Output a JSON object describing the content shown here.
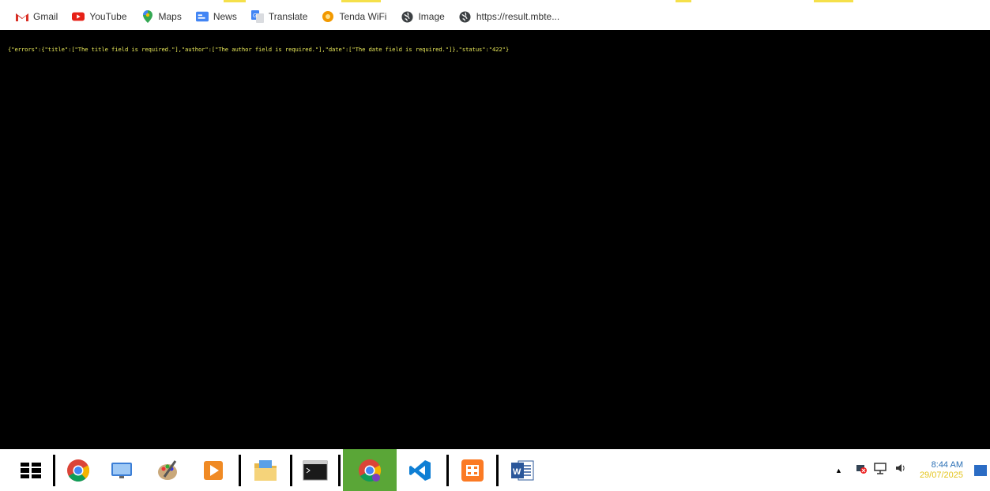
{
  "bookmarks": [
    {
      "label": "Gmail",
      "icon": "gmail-icon"
    },
    {
      "label": "YouTube",
      "icon": "youtube-icon"
    },
    {
      "label": "Maps",
      "icon": "maps-icon"
    },
    {
      "label": "News",
      "icon": "news-icon"
    },
    {
      "label": "Translate",
      "icon": "translate-icon"
    },
    {
      "label": "Tenda WiFi",
      "icon": "tenda-wifi-icon"
    },
    {
      "label": "Image",
      "icon": "globe-icon"
    },
    {
      "label": "https://result.mbte...",
      "icon": "globe-icon"
    }
  ],
  "response": {
    "text": "{\"errors\":{\"title\":[\"The title field is required.\"],\"author\":[\"The author field is required.\"],\"date\":[\"The date field is required.\"]},\"status\":\"422\"}"
  },
  "taskbar": {
    "apps": [
      "windows-start-icon",
      "chrome-icon",
      "remote-desktop-icon",
      "paint-icon",
      "media-player-icon",
      "file-explorer-icon",
      "terminal-icon",
      "chrome-profile-icon",
      "vscode-icon",
      "xampp-icon",
      "word-icon"
    ],
    "clock": {
      "time": "8:44 AM",
      "date": "29/07/2025"
    }
  },
  "colors": {
    "accent": "#e8e85a",
    "background": "#000000"
  }
}
